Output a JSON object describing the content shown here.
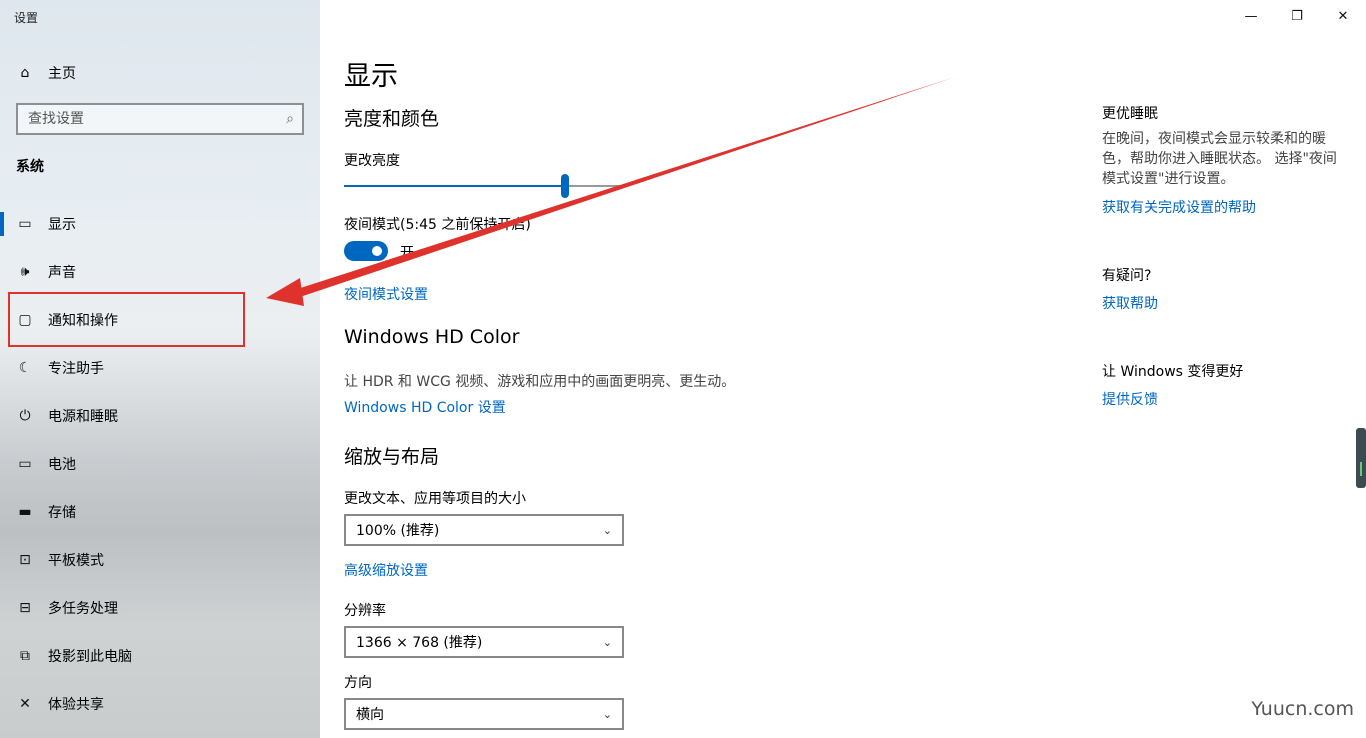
{
  "window": {
    "title": "设置",
    "minimize_icon": "minimize-icon",
    "restore_icon": "restore-icon",
    "close_icon": "close-icon"
  },
  "sidebar": {
    "home_label": "主页",
    "search_placeholder": "查找设置",
    "section": "系统",
    "items": [
      {
        "label": "显示",
        "icon": "monitor-icon",
        "selected": true
      },
      {
        "label": "声音",
        "icon": "speaker-icon"
      },
      {
        "label": "通知和操作",
        "icon": "notification-icon"
      },
      {
        "label": "专注助手",
        "icon": "moon-icon"
      },
      {
        "label": "电源和睡眠",
        "icon": "power-icon"
      },
      {
        "label": "电池",
        "icon": "battery-icon"
      },
      {
        "label": "存储",
        "icon": "storage-icon"
      },
      {
        "label": "平板模式",
        "icon": "tablet-icon"
      },
      {
        "label": "多任务处理",
        "icon": "multitask-icon"
      },
      {
        "label": "投影到此电脑",
        "icon": "project-icon"
      },
      {
        "label": "体验共享",
        "icon": "share-icon"
      }
    ]
  },
  "main": {
    "title": "显示",
    "brightness_heading": "亮度和颜色",
    "brightness_label": "更改亮度",
    "brightness_value": 0.79,
    "night_mode_label": "夜间模式(5:45 之前保持开启)",
    "night_mode_state": "开",
    "night_mode_settings_link": "夜间模式设置",
    "hdr_heading": "Windows HD Color",
    "hdr_desc": "让 HDR 和 WCG 视频、游戏和应用中的画面更明亮、更生动。",
    "hdr_link": "Windows HD Color 设置",
    "scale_heading": "缩放与布局",
    "scale_label": "更改文本、应用等项目的大小",
    "scale_value": "100% (推荐)",
    "advanced_scale_link": "高级缩放设置",
    "resolution_label": "分辨率",
    "resolution_value": "1366 × 768 (推荐)",
    "orientation_label": "方向",
    "orientation_value": "横向"
  },
  "right_panel": {
    "sleep_title": "更优睡眠",
    "sleep_desc": "在晚间，夜间模式会显示较柔和的暖色，帮助你进入睡眠状态。 选择\"夜间模式设置\"进行设置。",
    "sleep_link": "获取有关完成设置的帮助",
    "question_title": "有疑问?",
    "help_link": "获取帮助",
    "improve_title": "让 Windows 变得更好",
    "feedback_link": "提供反馈"
  },
  "watermark": "Yuucn.com",
  "colors": {
    "accent": "#0067c0",
    "annotation": "#e0322d"
  }
}
